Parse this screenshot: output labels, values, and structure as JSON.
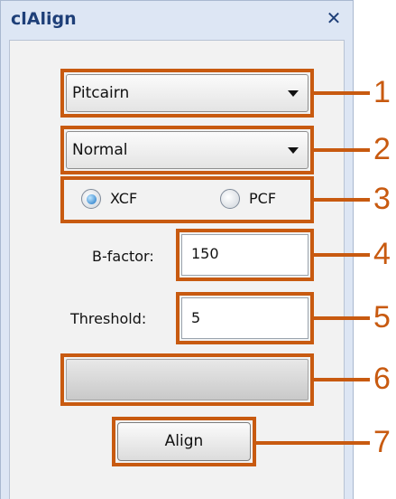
{
  "window": {
    "title": "clAlign",
    "close_glyph": "✕"
  },
  "combos": [
    {
      "value": "Pitcairn"
    },
    {
      "value": "Normal"
    }
  ],
  "radios": {
    "options": [
      {
        "label": "XCF",
        "selected": true
      },
      {
        "label": "PCF",
        "selected": false
      }
    ]
  },
  "bfactor": {
    "label": "B-factor:",
    "value": "150"
  },
  "threshold": {
    "label": "Threshold:",
    "value": "5"
  },
  "progress": {
    "fraction": 0
  },
  "align_button": {
    "label": "Align"
  },
  "callouts": [
    "1",
    "2",
    "3",
    "4",
    "5",
    "6",
    "7"
  ],
  "colors": {
    "callout": "#c85a10",
    "title": "#1e3f78",
    "panel": "#f2f2f2"
  }
}
